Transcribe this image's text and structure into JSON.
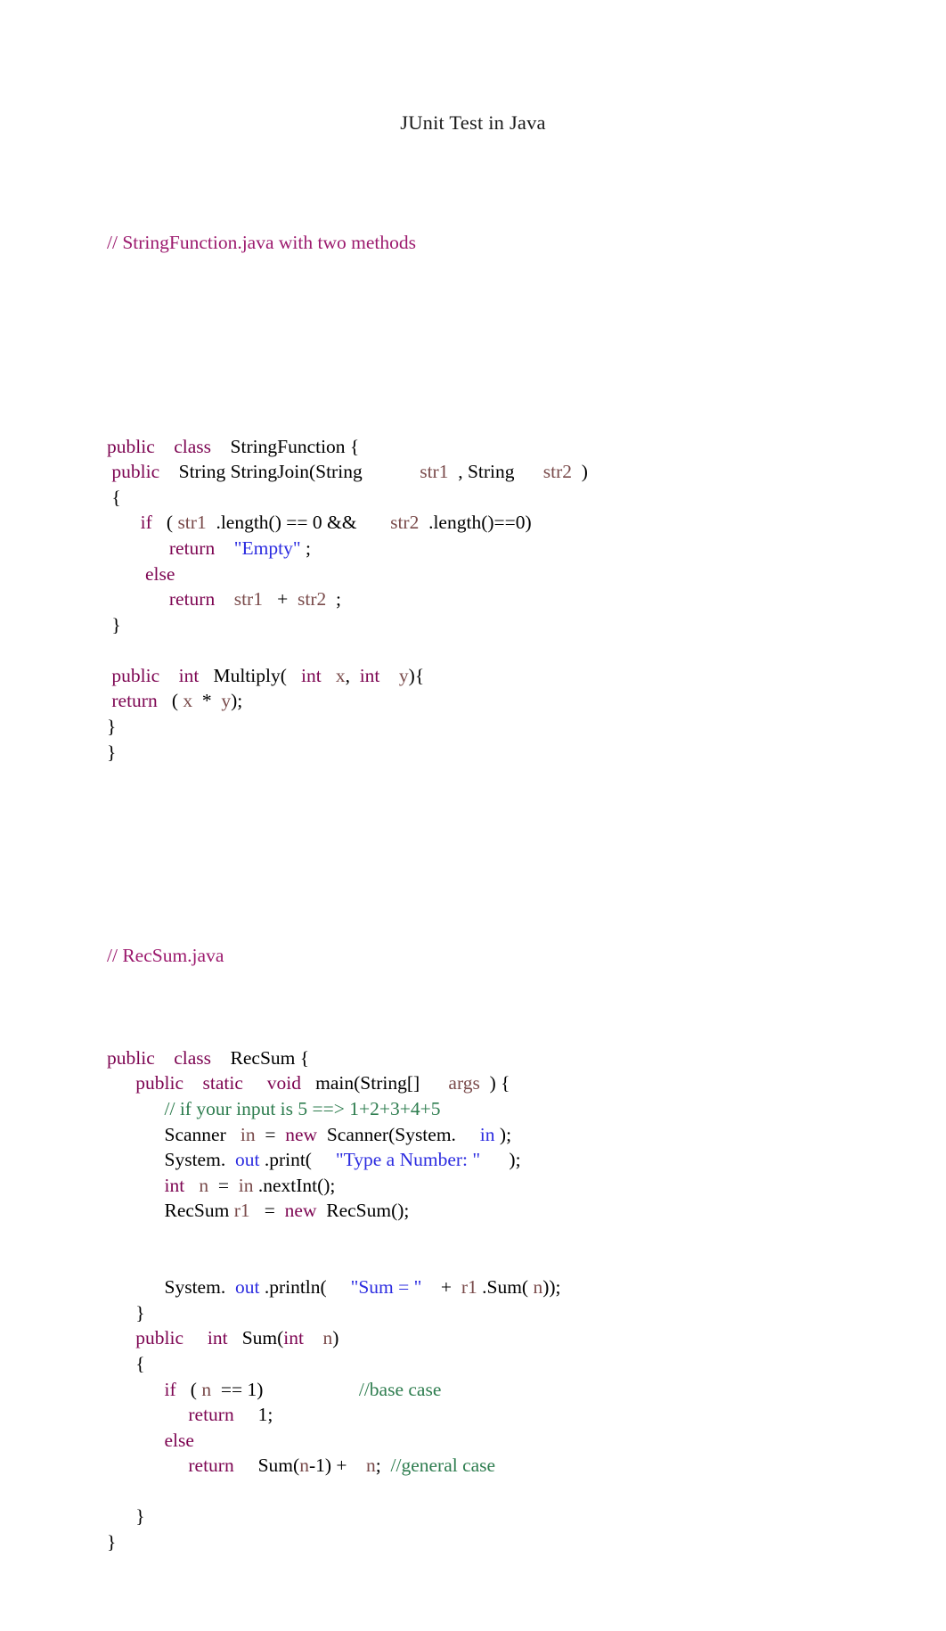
{
  "document": {
    "title": "JUnit Test in Java"
  },
  "colors": {
    "keyword": "#7d0552",
    "variable": "#7a4b4b",
    "string": "#2c2ce0",
    "field": "#2c2ce0",
    "comment": "#2e7d4f",
    "file_comment": "#9c1a6e",
    "plain": "#000000"
  },
  "code": {
    "listing1": {
      "file_comment": "// StringFunction.java with two methods",
      "lines": [
        {
          "id": "l1-class-decl",
          "tokens": [
            {
              "t": "public",
              "c": "kw"
            },
            {
              "t": "    ",
              "c": "pln"
            },
            {
              "t": "class",
              "c": "kw"
            },
            {
              "t": "    ",
              "c": "pln"
            },
            {
              "t": "StringFunction {",
              "c": "pln"
            }
          ]
        },
        {
          "id": "l1-stringjoin-sig",
          "tokens": [
            {
              "t": " ",
              "c": "pln"
            },
            {
              "t": "public",
              "c": "kw"
            },
            {
              "t": "    ",
              "c": "pln"
            },
            {
              "t": "String StringJoin(String",
              "c": "pln"
            },
            {
              "t": "            ",
              "c": "pln"
            },
            {
              "t": "str1",
              "c": "var"
            },
            {
              "t": "  , String",
              "c": "pln"
            },
            {
              "t": "      ",
              "c": "pln"
            },
            {
              "t": "str2",
              "c": "var"
            },
            {
              "t": "  )",
              "c": "pln"
            }
          ]
        },
        {
          "id": "l1-open-brace",
          "tokens": [
            {
              "t": " {",
              "c": "pln"
            }
          ]
        },
        {
          "id": "l1-if",
          "tokens": [
            {
              "t": "       ",
              "c": "pln"
            },
            {
              "t": "if",
              "c": "kw"
            },
            {
              "t": "   ( ",
              "c": "pln"
            },
            {
              "t": "str1",
              "c": "var"
            },
            {
              "t": "  .length() == 0 &&",
              "c": "pln"
            },
            {
              "t": "       ",
              "c": "pln"
            },
            {
              "t": "str2",
              "c": "var"
            },
            {
              "t": "  .length()==0)",
              "c": "pln"
            }
          ]
        },
        {
          "id": "l1-return-empty",
          "tokens": [
            {
              "t": "             ",
              "c": "pln"
            },
            {
              "t": "return",
              "c": "kw"
            },
            {
              "t": "    ",
              "c": "pln"
            },
            {
              "t": "\"Empty\"",
              "c": "str"
            },
            {
              "t": " ;",
              "c": "pln"
            }
          ]
        },
        {
          "id": "l1-else",
          "tokens": [
            {
              "t": "        ",
              "c": "pln"
            },
            {
              "t": "else",
              "c": "kw"
            }
          ]
        },
        {
          "id": "l1-return-concat",
          "tokens": [
            {
              "t": "             ",
              "c": "pln"
            },
            {
              "t": "return",
              "c": "kw"
            },
            {
              "t": "    ",
              "c": "pln"
            },
            {
              "t": "str1",
              "c": "var"
            },
            {
              "t": "   +  ",
              "c": "pln"
            },
            {
              "t": "str2",
              "c": "var"
            },
            {
              "t": "  ;",
              "c": "pln"
            }
          ]
        },
        {
          "id": "l1-close-method",
          "tokens": [
            {
              "t": " }",
              "c": "pln"
            }
          ]
        },
        {
          "id": "l1-blank-1",
          "tokens": []
        },
        {
          "id": "l1-multiply-sig",
          "tokens": [
            {
              "t": " ",
              "c": "pln"
            },
            {
              "t": "public",
              "c": "kw"
            },
            {
              "t": "    ",
              "c": "pln"
            },
            {
              "t": "int",
              "c": "kw"
            },
            {
              "t": "   Multiply(   ",
              "c": "pln"
            },
            {
              "t": "int",
              "c": "kw"
            },
            {
              "t": "   ",
              "c": "pln"
            },
            {
              "t": "x",
              "c": "var"
            },
            {
              "t": ",  ",
              "c": "pln"
            },
            {
              "t": "int",
              "c": "kw"
            },
            {
              "t": "    ",
              "c": "pln"
            },
            {
              "t": "y",
              "c": "var"
            },
            {
              "t": "){",
              "c": "pln"
            }
          ]
        },
        {
          "id": "l1-multiply-return",
          "tokens": [
            {
              "t": " ",
              "c": "pln"
            },
            {
              "t": "return",
              "c": "kw"
            },
            {
              "t": "   ( ",
              "c": "pln"
            },
            {
              "t": "x",
              "c": "var"
            },
            {
              "t": "  *  ",
              "c": "pln"
            },
            {
              "t": "y",
              "c": "var"
            },
            {
              "t": ");",
              "c": "pln"
            }
          ]
        },
        {
          "id": "l1-close-class-inner",
          "tokens": [
            {
              "t": "}",
              "c": "pln"
            }
          ]
        },
        {
          "id": "l1-close-class",
          "tokens": [
            {
              "t": "}",
              "c": "pln"
            }
          ]
        }
      ]
    },
    "listing2": {
      "file_comment": "// RecSum.java",
      "lines": [
        {
          "id": "l2-class-decl",
          "tokens": [
            {
              "t": "public",
              "c": "kw"
            },
            {
              "t": "    ",
              "c": "pln"
            },
            {
              "t": "class",
              "c": "kw"
            },
            {
              "t": "    ",
              "c": "pln"
            },
            {
              "t": "RecSum {",
              "c": "pln"
            }
          ]
        },
        {
          "id": "l2-main-sig",
          "tokens": [
            {
              "t": "      ",
              "c": "pln"
            },
            {
              "t": "public",
              "c": "kw"
            },
            {
              "t": "    ",
              "c": "pln"
            },
            {
              "t": "static",
              "c": "kw"
            },
            {
              "t": "     ",
              "c": "pln"
            },
            {
              "t": "void",
              "c": "kw"
            },
            {
              "t": "   main(String[]",
              "c": "pln"
            },
            {
              "t": "      ",
              "c": "pln"
            },
            {
              "t": "args",
              "c": "var"
            },
            {
              "t": "  ) {",
              "c": "pln"
            }
          ]
        },
        {
          "id": "l2-comment-input",
          "tokens": [
            {
              "t": "            ",
              "c": "pln"
            },
            {
              "t": "// if your input is 5 ==> 1+2+3+4+5",
              "c": "cmt"
            }
          ]
        },
        {
          "id": "l2-scanner",
          "tokens": [
            {
              "t": "            ",
              "c": "pln"
            },
            {
              "t": "Scanner",
              "c": "pln"
            },
            {
              "t": "   ",
              "c": "pln"
            },
            {
              "t": "in",
              "c": "var"
            },
            {
              "t": "  =  ",
              "c": "pln"
            },
            {
              "t": "new",
              "c": "kw"
            },
            {
              "t": "  Scanner(System.",
              "c": "pln"
            },
            {
              "t": "     ",
              "c": "pln"
            },
            {
              "t": "in",
              "c": "fld"
            },
            {
              "t": " );",
              "c": "pln"
            }
          ]
        },
        {
          "id": "l2-print",
          "tokens": [
            {
              "t": "            ",
              "c": "pln"
            },
            {
              "t": "System.",
              "c": "pln"
            },
            {
              "t": "  ",
              "c": "pln"
            },
            {
              "t": "out",
              "c": "fld"
            },
            {
              "t": " .print(     ",
              "c": "pln"
            },
            {
              "t": "\"Type a Number: \"",
              "c": "str"
            },
            {
              "t": "      );",
              "c": "pln"
            }
          ]
        },
        {
          "id": "l2-int-n",
          "tokens": [
            {
              "t": "            ",
              "c": "pln"
            },
            {
              "t": "int",
              "c": "kw"
            },
            {
              "t": "   ",
              "c": "pln"
            },
            {
              "t": "n",
              "c": "var"
            },
            {
              "t": "  =  ",
              "c": "pln"
            },
            {
              "t": "in",
              "c": "var"
            },
            {
              "t": " .nextInt();",
              "c": "pln"
            }
          ]
        },
        {
          "id": "l2-new-recsum",
          "tokens": [
            {
              "t": "            ",
              "c": "pln"
            },
            {
              "t": "RecSum ",
              "c": "pln"
            },
            {
              "t": "r1",
              "c": "var"
            },
            {
              "t": "   =  ",
              "c": "pln"
            },
            {
              "t": "new",
              "c": "kw"
            },
            {
              "t": "  RecSum();",
              "c": "pln"
            }
          ]
        },
        {
          "id": "l2-blank-1",
          "tokens": []
        },
        {
          "id": "l2-blank-2",
          "tokens": []
        },
        {
          "id": "l2-println",
          "tokens": [
            {
              "t": "            ",
              "c": "pln"
            },
            {
              "t": "System.",
              "c": "pln"
            },
            {
              "t": "  ",
              "c": "pln"
            },
            {
              "t": "out",
              "c": "fld"
            },
            {
              "t": " .println(     ",
              "c": "pln"
            },
            {
              "t": "\"Sum = \"",
              "c": "str"
            },
            {
              "t": "    +  ",
              "c": "pln"
            },
            {
              "t": "r1",
              "c": "var"
            },
            {
              "t": " .Sum( ",
              "c": "pln"
            },
            {
              "t": "n",
              "c": "var"
            },
            {
              "t": "));",
              "c": "pln"
            }
          ]
        },
        {
          "id": "l2-close-main",
          "tokens": [
            {
              "t": "      }",
              "c": "pln"
            }
          ]
        },
        {
          "id": "l2-sum-sig",
          "tokens": [
            {
              "t": "      ",
              "c": "pln"
            },
            {
              "t": "public",
              "c": "kw"
            },
            {
              "t": "     ",
              "c": "pln"
            },
            {
              "t": "int",
              "c": "kw"
            },
            {
              "t": "   Sum(",
              "c": "pln"
            },
            {
              "t": "int",
              "c": "kw"
            },
            {
              "t": "    ",
              "c": "pln"
            },
            {
              "t": "n",
              "c": "var"
            },
            {
              "t": ")",
              "c": "pln"
            }
          ]
        },
        {
          "id": "l2-sum-open",
          "tokens": [
            {
              "t": "      {",
              "c": "pln"
            }
          ]
        },
        {
          "id": "l2-if-base",
          "tokens": [
            {
              "t": "            ",
              "c": "pln"
            },
            {
              "t": "if",
              "c": "kw"
            },
            {
              "t": "   ( ",
              "c": "pln"
            },
            {
              "t": "n",
              "c": "var"
            },
            {
              "t": "  == 1)",
              "c": "pln"
            },
            {
              "t": "                    ",
              "c": "pln"
            },
            {
              "t": "//base case",
              "c": "cmt"
            }
          ]
        },
        {
          "id": "l2-return-1",
          "tokens": [
            {
              "t": "                 ",
              "c": "pln"
            },
            {
              "t": "return",
              "c": "kw"
            },
            {
              "t": "     1;",
              "c": "pln"
            }
          ]
        },
        {
          "id": "l2-else",
          "tokens": [
            {
              "t": "            ",
              "c": "pln"
            },
            {
              "t": "else",
              "c": "kw"
            }
          ]
        },
        {
          "id": "l2-return-rec",
          "tokens": [
            {
              "t": "                 ",
              "c": "pln"
            },
            {
              "t": "return",
              "c": "kw"
            },
            {
              "t": "     Sum(",
              "c": "pln"
            },
            {
              "t": "n",
              "c": "var"
            },
            {
              "t": "-1) +    ",
              "c": "pln"
            },
            {
              "t": "n",
              "c": "var"
            },
            {
              "t": ";  ",
              "c": "pln"
            },
            {
              "t": "//general case",
              "c": "cmt"
            }
          ]
        },
        {
          "id": "l2-blank-3",
          "tokens": []
        },
        {
          "id": "l2-close-sum",
          "tokens": [
            {
              "t": "      }",
              "c": "pln"
            }
          ]
        },
        {
          "id": "l2-close-class",
          "tokens": [
            {
              "t": "}",
              "c": "pln"
            }
          ]
        }
      ]
    }
  }
}
